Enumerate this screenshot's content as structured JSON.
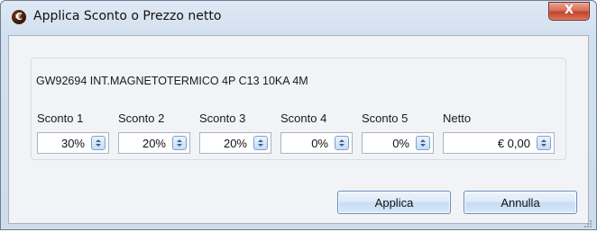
{
  "window": {
    "title": "Applica Sconto o Prezzo netto",
    "close_label": "X",
    "icon": "euro-icon"
  },
  "product": {
    "description": "GW92694 INT.MAGNETOTERMICO 4P C13 10KA 4M"
  },
  "fields": [
    {
      "label": "Sconto 1",
      "value": "30%"
    },
    {
      "label": "Sconto 2",
      "value": "20%"
    },
    {
      "label": "Sconto 3",
      "value": "20%"
    },
    {
      "label": "Sconto 4",
      "value": "0%"
    },
    {
      "label": "Sconto 5",
      "value": "0%"
    },
    {
      "label": "Netto",
      "value": "€ 0,00"
    }
  ],
  "buttons": {
    "apply_label": "Applica",
    "cancel_label": "Annulla"
  },
  "colors": {
    "accent": "#6a8ec2",
    "close": "#c2432a"
  }
}
